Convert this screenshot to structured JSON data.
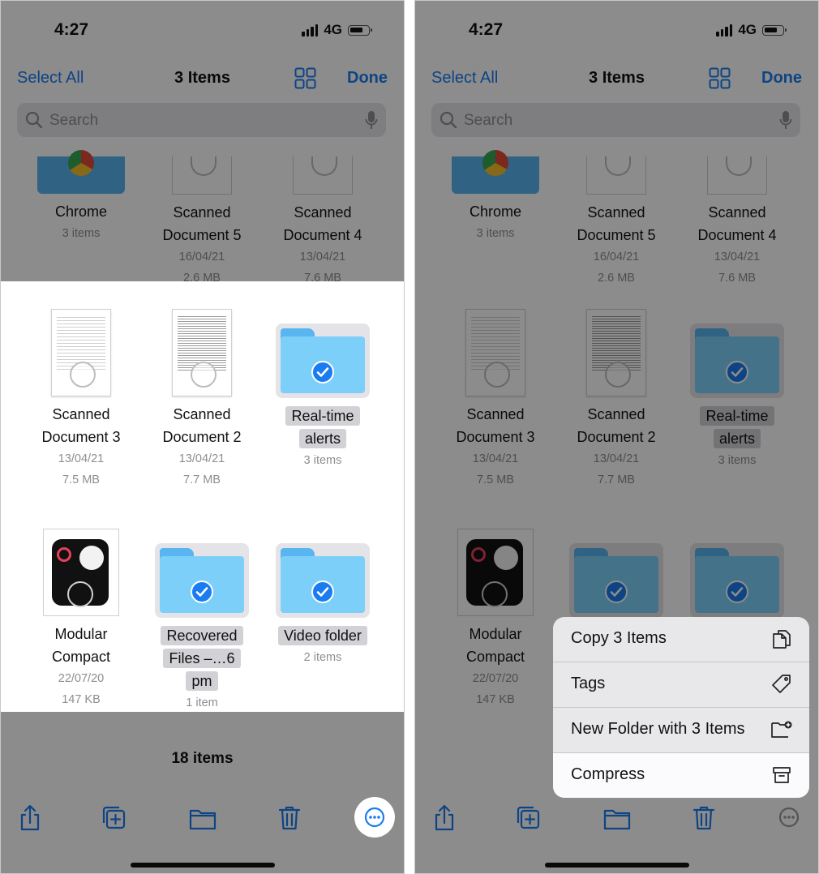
{
  "status": {
    "time": "4:27",
    "network": "4G"
  },
  "nav": {
    "select_all": "Select All",
    "title": "3 Items",
    "done": "Done"
  },
  "search": {
    "placeholder": "Search"
  },
  "top_row": [
    {
      "name": "Chrome",
      "meta": [
        "3 items"
      ]
    },
    {
      "name": "Scanned Document 5",
      "meta": [
        "16/04/21",
        "2.6 MB"
      ]
    },
    {
      "name": "Scanned Document 4",
      "meta": [
        "13/04/21",
        "7.6 MB"
      ]
    }
  ],
  "files": [
    {
      "name": "Scanned Document 3",
      "meta": [
        "13/04/21",
        "7.5 MB"
      ],
      "type": "document",
      "selected": false
    },
    {
      "name": "Scanned Document 2",
      "meta": [
        "13/04/21",
        "7.7 MB"
      ],
      "type": "document",
      "selected": false
    },
    {
      "name": "Real-time alerts",
      "meta": [
        "3 items"
      ],
      "type": "folder",
      "selected": true
    },
    {
      "name": "Modular Compact",
      "meta": [
        "22/07/20",
        "147 KB"
      ],
      "type": "image",
      "selected": false
    },
    {
      "name": "Recovered Files –…6 pm",
      "meta": [
        "1 item"
      ],
      "type": "folder",
      "selected": true
    },
    {
      "name": "Video folder",
      "meta": [
        "2 items"
      ],
      "type": "folder",
      "selected": true
    }
  ],
  "footer": {
    "count": "18 items"
  },
  "toolbar_icons": [
    "share-icon",
    "duplicate-icon",
    "folder-icon",
    "trash-icon",
    "more-icon"
  ],
  "context_menu": [
    {
      "label": "Copy 3 Items",
      "icon": "copy-icon"
    },
    {
      "label": "Tags",
      "icon": "tag-icon"
    },
    {
      "label": "New Folder with 3 Items",
      "icon": "new-folder-icon"
    },
    {
      "label": "Compress",
      "icon": "archive-icon"
    }
  ],
  "colors": {
    "accent": "#1a7cf0",
    "folder": "#7ccff8",
    "dim_overlay": "rgba(0,0,0,0.45)"
  }
}
